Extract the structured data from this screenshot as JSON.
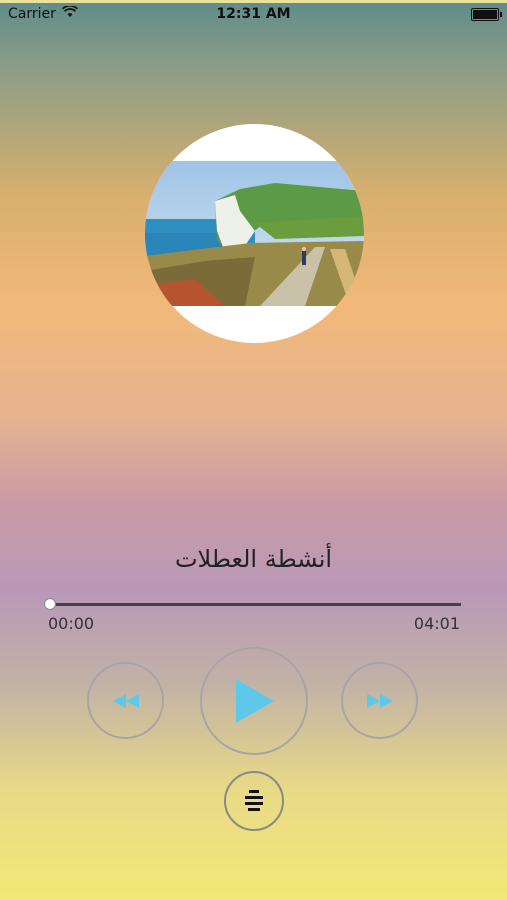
{
  "status_bar": {
    "carrier": "Carrier",
    "time": "12:31 AM"
  },
  "player": {
    "title": "أنشطة العطلات",
    "elapsed": "00:00",
    "duration": "04:01",
    "progress": 0.0
  },
  "icons": {
    "wifi": "wifi-icon",
    "battery": "battery-icon",
    "rewind": "rewind-icon",
    "play": "play-icon",
    "forward": "fast-forward-icon",
    "playlist": "playlist-icon"
  },
  "colors": {
    "accent": "#5ec8ea",
    "button_border": "#a9a3a8"
  }
}
